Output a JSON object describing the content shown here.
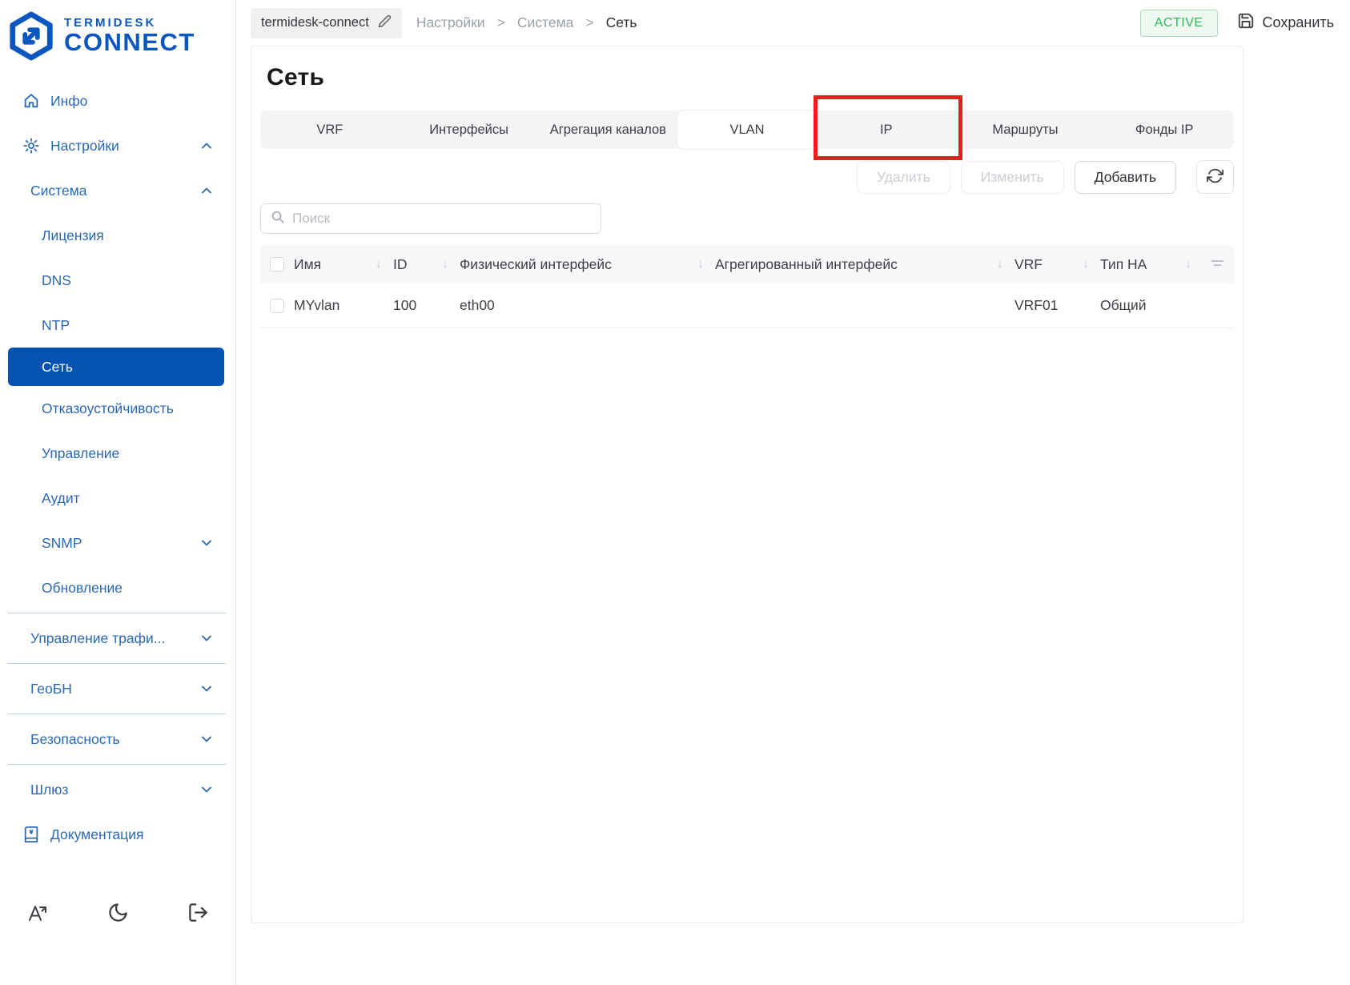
{
  "brand": {
    "line1": "TERMIDESK",
    "line2": "CONNECT"
  },
  "colors": {
    "brand_blue": "#0b57bf",
    "nav_blue": "#2a68b4",
    "selected_item_bg": "#0453b2",
    "status_green": "#2eb85c",
    "annotation_red": "#e3201d"
  },
  "sidebar": {
    "items": [
      {
        "label": "Инфо",
        "icon": "home"
      },
      {
        "label": "Настройки",
        "icon": "gear",
        "chevron": "up"
      },
      {
        "label": "Система",
        "chevron": "up"
      },
      {
        "label": "Лицензия"
      },
      {
        "label": "DNS"
      },
      {
        "label": "NTP"
      },
      {
        "label": "Сеть",
        "selected": true
      },
      {
        "label": "Отказоустойчивость"
      },
      {
        "label": "Управление"
      },
      {
        "label": "Аудит"
      },
      {
        "label": "SNMP",
        "chevron": "down"
      },
      {
        "label": "Обновление"
      },
      {
        "label": "Управление трафи...",
        "chevron": "down"
      },
      {
        "label": "ГеоБН",
        "chevron": "down"
      },
      {
        "label": "Безопасность",
        "chevron": "down"
      },
      {
        "label": "Шлюз",
        "chevron": "down"
      },
      {
        "label": "Документация",
        "icon": "book"
      }
    ],
    "footer_icons": [
      {
        "name": "language"
      },
      {
        "name": "dark-mode"
      },
      {
        "name": "logout"
      }
    ]
  },
  "header": {
    "hostname": "termidesk-connect",
    "breadcrumb": {
      "items": [
        "Настройки",
        "Система",
        "Сеть"
      ],
      "separator": ">"
    },
    "status_badge": "ACTIVE",
    "save_label": "Сохранить"
  },
  "page": {
    "title": "Сеть",
    "tabs": {
      "items": [
        {
          "label": "VRF"
        },
        {
          "label": "Интерфейсы"
        },
        {
          "label": "Агрегация каналов"
        },
        {
          "label": "VLAN"
        },
        {
          "label": "IP"
        },
        {
          "label": "Маршруты"
        },
        {
          "label": "Фонды IP"
        }
      ],
      "active_label": "VLAN",
      "highlighted_label": "IP"
    },
    "actions": {
      "delete": "Удалить",
      "edit": "Изменить",
      "add": "Добавить"
    },
    "search_placeholder": "Поиск",
    "table": {
      "columns": [
        "Имя",
        "ID",
        "Физический интерфейс",
        "Агрегированный интерфейс",
        "VRF",
        "Тип HA"
      ],
      "sort_glyph": "↓",
      "rows": [
        {
          "cells": [
            "MYvlan",
            "100",
            "eth00",
            "",
            "VRF01",
            "Общий"
          ]
        }
      ]
    }
  },
  "icons": {
    "home": "house-outline",
    "gear": "cog",
    "chevron_up": "chevron-up",
    "chevron_down": "chevron-down",
    "book": "book",
    "edit": "pencil",
    "save": "floppy-disk",
    "refresh": "circular-arrows",
    "search": "magnifier",
    "sort": "down-arrow",
    "filter": "filter-lines",
    "language": "letter-A-arrow",
    "dark-mode": "crescent-moon",
    "logout": "door-exit-arrow"
  }
}
